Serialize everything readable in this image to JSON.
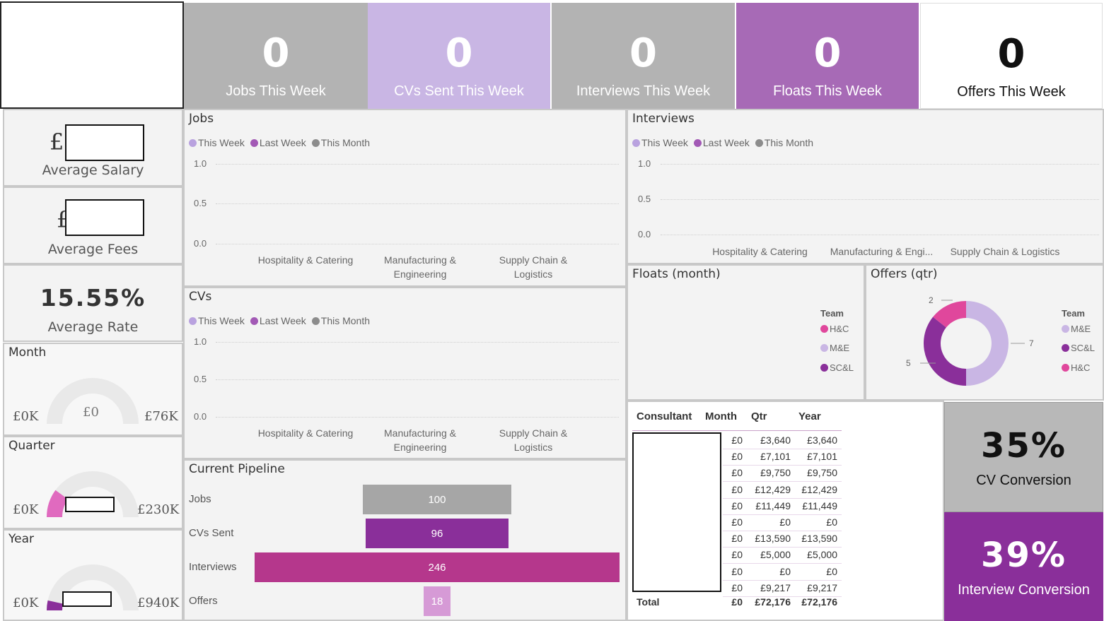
{
  "kpis": [
    {
      "value": "0",
      "label": "Jobs This Week",
      "bg": "#b3b3b3",
      "fg": "#ffffff"
    },
    {
      "value": "0",
      "label": "CVs Sent This Week",
      "bg": "#c9b6e4",
      "fg": "#ffffff"
    },
    {
      "value": "0",
      "label": "Interviews This Week",
      "bg": "#b3b3b3",
      "fg": "#ffffff"
    },
    {
      "value": "0",
      "label": "Floats This Week",
      "bg": "#a76ab6",
      "fg": "#ffffff"
    },
    {
      "value": "0",
      "label": "Offers This Week",
      "bg": "#ffffff",
      "fg": "#111111"
    }
  ],
  "stats": {
    "salary_symbol": "£",
    "salary_label": "Average Salary",
    "fees_symbol": "£",
    "fees_label": "Average Fees",
    "rate_value": "15.55%",
    "rate_label": "Average Rate"
  },
  "gauges": {
    "month": {
      "title": "Month",
      "min": "£0K",
      "max": "£76K",
      "value": "£0",
      "fraction": 0
    },
    "quarter": {
      "title": "Quarter",
      "min": "£0K",
      "max": "£230K",
      "fraction": 0.2
    },
    "year": {
      "title": "Year",
      "min": "£0K",
      "max": "£940K",
      "fraction": 0.07
    }
  },
  "legend_series": [
    {
      "name": "This Week",
      "color": "#b9a2df"
    },
    {
      "name": "Last Week",
      "color": "#a259b5"
    },
    {
      "name": "This Month",
      "color": "#8c8c8c"
    }
  ],
  "jobs_chart": {
    "title": "Jobs",
    "yticks": [
      "1.0",
      "0.5",
      "0.0"
    ],
    "categories": [
      "Hospitality & Catering",
      "Manufacturing & Engineering",
      "Supply Chain & Logistics"
    ],
    "category_lines": [
      [
        "Hospitality & Catering"
      ],
      [
        "Manufacturing &",
        "Engineering"
      ],
      [
        "Supply Chain &",
        "Logistics"
      ]
    ]
  },
  "cvs_chart": {
    "title": "CVs",
    "yticks": [
      "1.0",
      "0.5",
      "0.0"
    ],
    "category_lines": [
      [
        "Hospitality & Catering"
      ],
      [
        "Manufacturing &",
        "Engineering"
      ],
      [
        "Supply Chain &",
        "Logistics"
      ]
    ]
  },
  "interviews_chart": {
    "title": "Interviews",
    "yticks": [
      "1.0",
      "0.5",
      "0.0"
    ],
    "categories": [
      "Hospitality & Catering",
      "Manufacturing & Engi...",
      "Supply Chain & Logistics"
    ]
  },
  "pipeline": {
    "title": "Current Pipeline",
    "stages": [
      {
        "label": "Jobs",
        "value": 100,
        "color": "#a6a6a6"
      },
      {
        "label": "CVs Sent",
        "value": 96,
        "color": "#8a2f9a"
      },
      {
        "label": "Interviews",
        "value": 246,
        "color": "#b5378c"
      },
      {
        "label": "Offers",
        "value": 18,
        "color": "#d69ad6"
      }
    ]
  },
  "floats": {
    "title": "Floats (month)",
    "legend_title": "Team",
    "legend": [
      {
        "name": "H&C",
        "color": "#e0479c"
      },
      {
        "name": "M&E",
        "color": "#c9b6e4"
      },
      {
        "name": "SC&L",
        "color": "#8a2f9a"
      }
    ]
  },
  "offers": {
    "title": "Offers (qtr)",
    "legend_title": "Team",
    "legend": [
      {
        "name": "M&E",
        "color": "#c9b6e4"
      },
      {
        "name": "SC&L",
        "color": "#8a2f9a"
      },
      {
        "name": "H&C",
        "color": "#e0479c"
      }
    ],
    "chart_data": {
      "type": "pie",
      "series": [
        {
          "name": "M&E",
          "value": 7,
          "color": "#c9b6e4"
        },
        {
          "name": "SC&L",
          "value": 5,
          "color": "#8a2f9a"
        },
        {
          "name": "H&C",
          "value": 2,
          "color": "#e0479c"
        }
      ],
      "labels": [
        "7",
        "5",
        "2"
      ]
    }
  },
  "consultants": {
    "headers": [
      "Consultant",
      "Month",
      "Qtr",
      "Year"
    ],
    "rows": [
      [
        "£0",
        "£3,640",
        "£3,640"
      ],
      [
        "£0",
        "£7,101",
        "£7,101"
      ],
      [
        "£0",
        "£9,750",
        "£9,750"
      ],
      [
        "£0",
        "£12,429",
        "£12,429"
      ],
      [
        "£0",
        "£11,449",
        "£11,449"
      ],
      [
        "£0",
        "£0",
        "£0"
      ],
      [
        "£0",
        "£13,590",
        "£13,590"
      ],
      [
        "£0",
        "£5,000",
        "£5,000"
      ],
      [
        "£0",
        "£0",
        "£0"
      ],
      [
        "£0",
        "£9,217",
        "£9,217"
      ]
    ],
    "total_label": "Total",
    "total": [
      "£0",
      "£72,176",
      "£72,176"
    ]
  },
  "conversion": {
    "cv": {
      "value": "35%",
      "label": "CV Conversion",
      "bg": "#b8b8b8"
    },
    "interview": {
      "value": "39%",
      "label": "Interview Conversion",
      "bg": "#8a2f9a"
    }
  }
}
